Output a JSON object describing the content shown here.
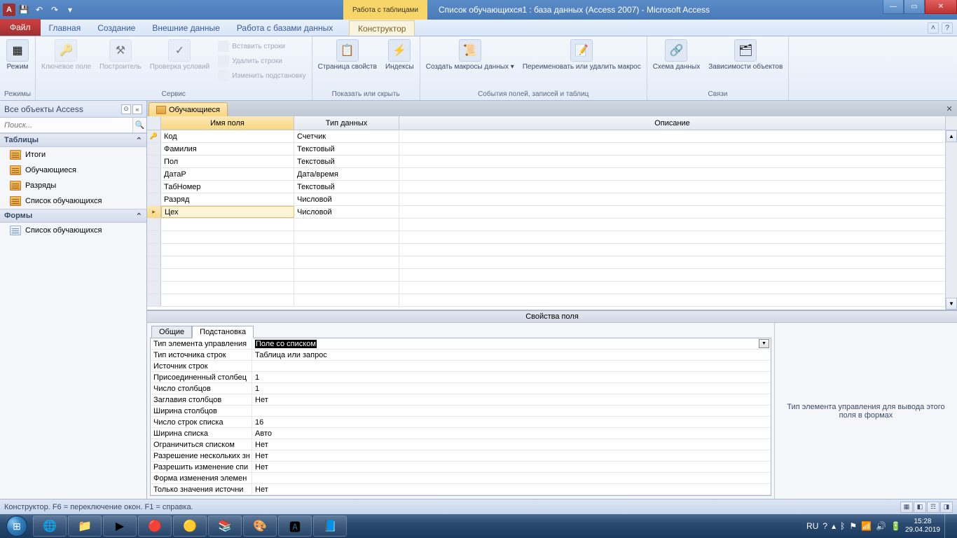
{
  "titlebar": {
    "context_tab": "Работа с таблицами",
    "title": "Список обучающихся1 : база данных (Access 2007)  -  Microsoft Access"
  },
  "ribbon_tabs": {
    "file": "Файл",
    "tabs": [
      "Главная",
      "Создание",
      "Внешние данные",
      "Работа с базами данных"
    ],
    "context": "Конструктор"
  },
  "ribbon": {
    "g1": {
      "label": "Режимы",
      "btn1": "Режим"
    },
    "g2": {
      "label": "Сервис",
      "b1": "Ключевое\nполе",
      "b2": "Построитель",
      "b3": "Проверка\nусловий",
      "s1": "Вставить строки",
      "s2": "Удалить строки",
      "s3": "Изменить подстановку"
    },
    "g3": {
      "label": "Показать или скрыть",
      "b1": "Страница\nсвойств",
      "b2": "Индексы"
    },
    "g4": {
      "label": "События полей, записей и таблиц",
      "b1": "Создать макросы\nданных ▾",
      "b2": "Переименовать\nили удалить макрос"
    },
    "g5": {
      "label": "Связи",
      "b1": "Схема\nданных",
      "b2": "Зависимости\nобъектов"
    }
  },
  "nav": {
    "header": "Все объекты Access",
    "search_ph": "Поиск...",
    "groups": [
      {
        "title": "Таблицы",
        "items": [
          "Итоги",
          "Обучающиеся",
          "Разряды",
          "Список обучающихся"
        ],
        "type": "table"
      },
      {
        "title": "Формы",
        "items": [
          "Список обучающихся"
        ],
        "type": "form"
      }
    ]
  },
  "doc": {
    "tab": "Обучающиеся",
    "columns": {
      "name": "Имя поля",
      "type": "Тип данных",
      "desc": "Описание"
    },
    "rows": [
      {
        "name": "Код",
        "type": "Счетчик",
        "pk": true
      },
      {
        "name": "Фамилия",
        "type": "Текстовый"
      },
      {
        "name": "Пол",
        "type": "Текстовый"
      },
      {
        "name": "ДатаР",
        "type": "Дата/время"
      },
      {
        "name": "ТабНомер",
        "type": "Текстовый"
      },
      {
        "name": "Разряд",
        "type": "Числовой"
      },
      {
        "name": "Цех",
        "type": "Числовой",
        "selected": true
      }
    ]
  },
  "props": {
    "title": "Свойства поля",
    "tabs": [
      "Общие",
      "Подстановка"
    ],
    "active_tab": 1,
    "rows": [
      {
        "n": "Тип элемента управления",
        "v": "Поле со списком",
        "sel": true
      },
      {
        "n": "Тип источника строк",
        "v": "Таблица или запрос"
      },
      {
        "n": "Источник строк",
        "v": ""
      },
      {
        "n": "Присоединенный столбец",
        "v": "1"
      },
      {
        "n": "Число столбцов",
        "v": "1"
      },
      {
        "n": "Заглавия столбцов",
        "v": "Нет"
      },
      {
        "n": "Ширина столбцов",
        "v": ""
      },
      {
        "n": "Число строк списка",
        "v": "16"
      },
      {
        "n": "Ширина списка",
        "v": "Авто"
      },
      {
        "n": "Ограничиться списком",
        "v": "Нет"
      },
      {
        "n": "Разрешение нескольких зн",
        "v": "Нет"
      },
      {
        "n": "Разрешить изменение спи",
        "v": "Нет"
      },
      {
        "n": "Форма изменения элемен",
        "v": ""
      },
      {
        "n": "Только значения источни",
        "v": "Нет"
      }
    ],
    "hint": "Тип элемента управления для вывода этого поля в формах"
  },
  "status": {
    "text": "Конструктор.   F6 = переключение окон.   F1 = справка."
  },
  "tray": {
    "lang": "RU",
    "time": "15:28",
    "date": "29.04.2019"
  }
}
